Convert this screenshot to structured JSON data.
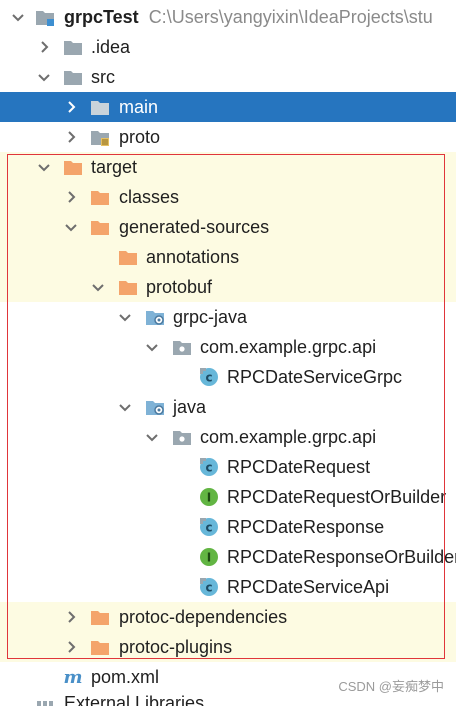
{
  "tree": {
    "root": {
      "name": "grpcTest",
      "path": "C:\\Users\\yangyixin\\IdeaProjects\\stu"
    },
    "items": [
      {
        "label": ".idea"
      },
      {
        "label": "src"
      },
      {
        "label": "main"
      },
      {
        "label": "proto"
      },
      {
        "label": "target"
      },
      {
        "label": "classes"
      },
      {
        "label": "generated-sources"
      },
      {
        "label": "annotations"
      },
      {
        "label": "protobuf"
      },
      {
        "label": "grpc-java"
      },
      {
        "label": "com.example.grpc.api"
      },
      {
        "label": "RPCDateServiceGrpc"
      },
      {
        "label": "java"
      },
      {
        "label": "com.example.grpc.api"
      },
      {
        "label": "RPCDateRequest"
      },
      {
        "label": "RPCDateRequestOrBuilder"
      },
      {
        "label": "RPCDateResponse"
      },
      {
        "label": "RPCDateResponseOrBuilder"
      },
      {
        "label": "RPCDateServiceApi"
      },
      {
        "label": "protoc-dependencies"
      },
      {
        "label": "protoc-plugins"
      },
      {
        "label": "pom.xml"
      },
      {
        "label": "External Libraries"
      }
    ]
  },
  "watermark": "CSDN @妄痴梦中",
  "colors": {
    "selection": "#2675bf",
    "highlight_row": "#fdfbe2",
    "annotation_box": "#e0353a",
    "folder_gray": "#9aa7b0",
    "folder_orange": "#f4a46b",
    "class_icon": "#67b7d9",
    "interface_icon": "#62b543"
  }
}
